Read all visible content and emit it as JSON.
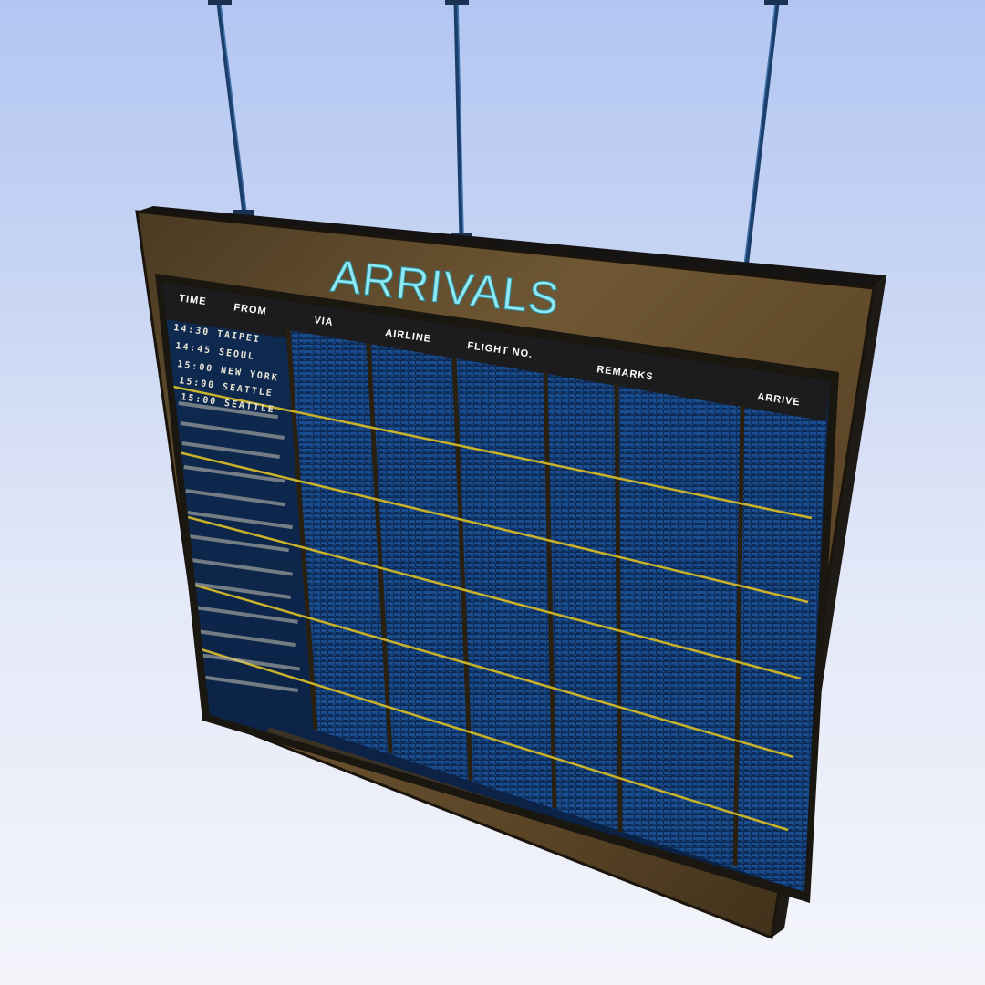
{
  "board": {
    "title": "ARRIVALS",
    "columns": [
      "TIME",
      "FROM",
      "VIA",
      "AIRLINE",
      "FLIGHT NO.",
      "REMARKS",
      "ARRIVE"
    ],
    "rows": [
      "14:30 TAIPEI",
      "14:45 SEOUL",
      "15:00 NEW YORK",
      "15:00 SEATTLE",
      "15:00 SEATTLE"
    ]
  }
}
